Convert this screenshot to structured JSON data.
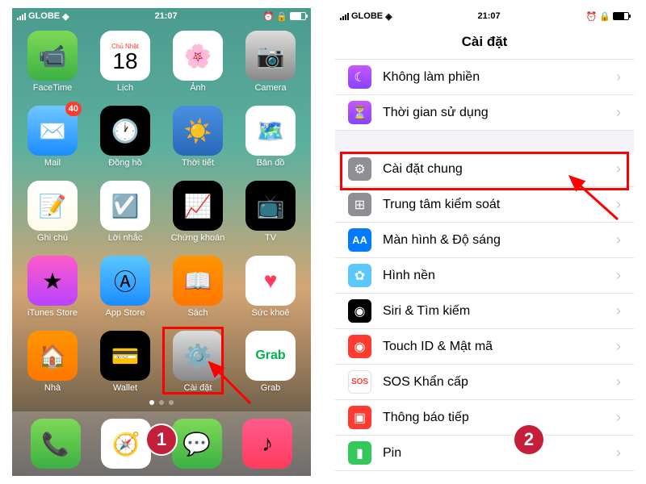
{
  "status": {
    "carrier": "GLOBE",
    "time": "21:07"
  },
  "step1": {
    "badge": "1"
  },
  "step2": {
    "badge": "2"
  },
  "calendar": {
    "dow": "Chủ Nhật",
    "day": "18"
  },
  "apps": {
    "facetime": "FaceTime",
    "calendar": "Lịch",
    "photos": "Ảnh",
    "camera": "Camera",
    "mail": "Mail",
    "mail_badge": "40",
    "clock": "Đồng hồ",
    "weather": "Thời tiết",
    "maps": "Bản đồ",
    "notes": "Ghi chú",
    "reminders": "Lời nhắc",
    "stocks": "Chứng khoán",
    "tv": "TV",
    "itunes": "iTunes Store",
    "appstore": "App Store",
    "books": "Sách",
    "health": "Sức khoẻ",
    "home": "Nhà",
    "wallet": "Wallet",
    "settings": "Cài đặt",
    "grab": "Grab",
    "grab_logo": "Grab"
  },
  "settings": {
    "title": "Cài đặt",
    "dnd": "Không làm phiền",
    "screentime": "Thời gian sử dụng",
    "general": "Cài đặt chung",
    "control": "Trung tâm kiểm soát",
    "display": "Màn hình & Độ sáng",
    "wallpaper": "Hình nền",
    "siri": "Siri & Tìm kiếm",
    "touchid": "Touch ID & Mật mã",
    "sos": "SOS Khẩn cấp",
    "sos_icon": "SOS",
    "notif": "Thông báo tiếp",
    "battery": "Pin",
    "aa": "AA"
  }
}
